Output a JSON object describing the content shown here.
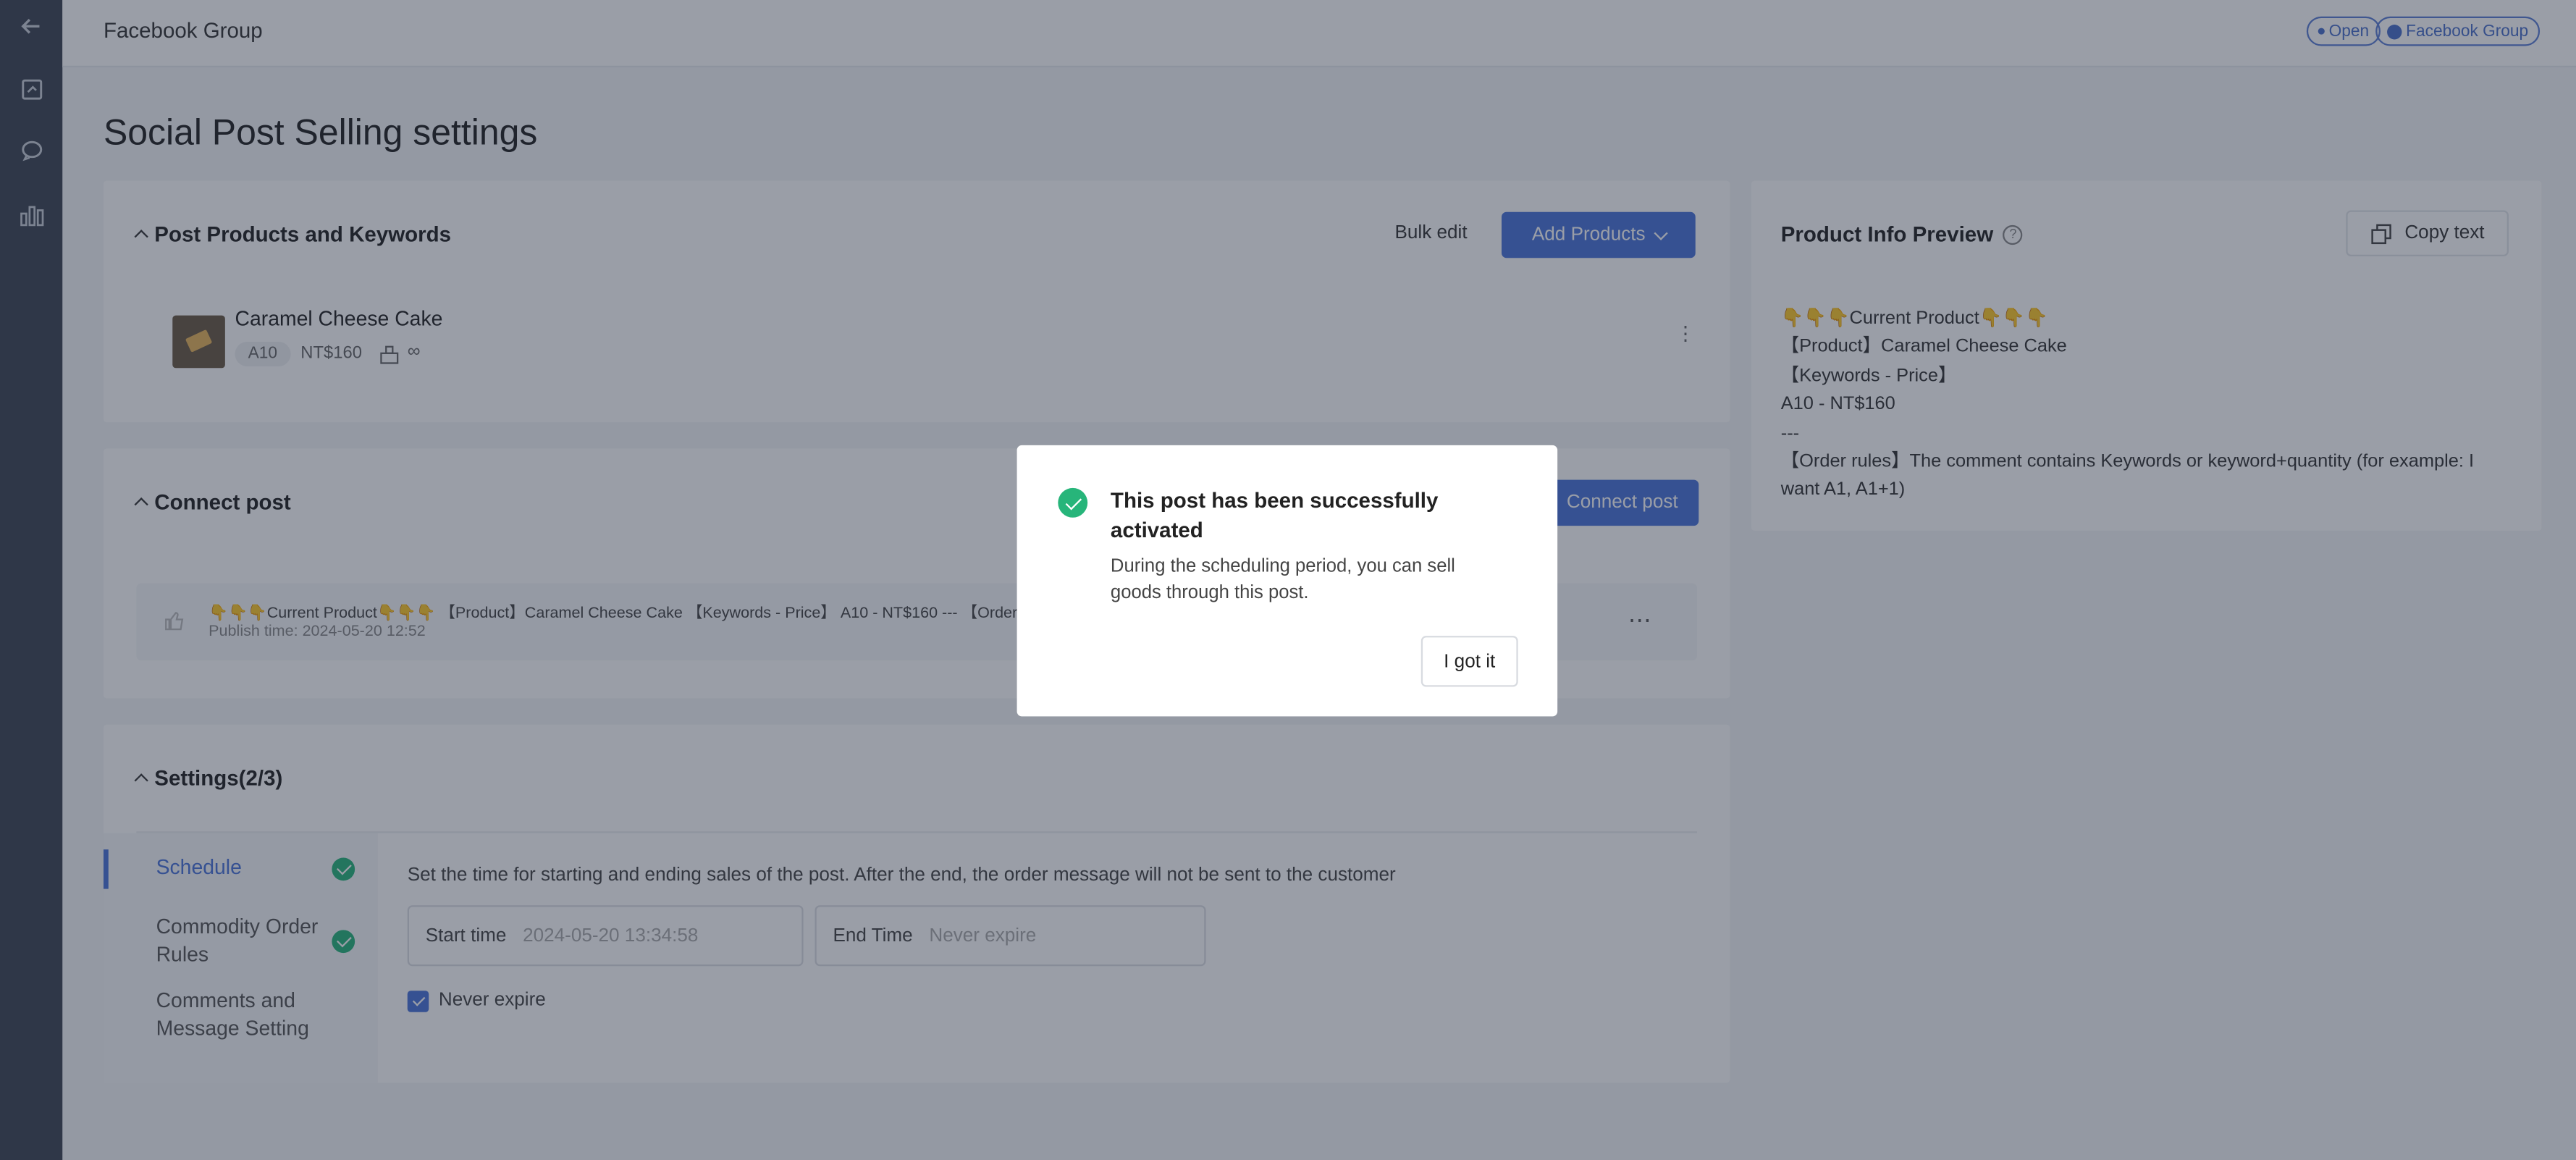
{
  "topbar": {
    "title": "Facebook Group",
    "status_pill": "Open",
    "group_pill": "Facebook Group"
  },
  "page": {
    "title": "Social Post Selling settings"
  },
  "products_card": {
    "title": "Post Products and Keywords",
    "bulk_edit_label": "Bulk edit",
    "add_products_label": "Add Products",
    "product": {
      "name": "Caramel Cheese Cake",
      "keyword": "A10",
      "price": "NT$160",
      "stock": "∞"
    }
  },
  "connect_card": {
    "title": "Connect post",
    "connect_button": "Connect post",
    "post_text": "👇👇👇Current Product👇👇👇 【Product】Caramel Cheese Cake 【Keywords - Price】 A10 - NT$160 --- 【Order rules】The comment contains Keywords or keyword+quantity (for exampl...",
    "publish_time": "Publish time: 2024-05-20 12:52"
  },
  "settings_card": {
    "title": "Settings(2/3)",
    "tabs": [
      {
        "label": "Schedule",
        "done": true
      },
      {
        "label": "Commodity Order Rules",
        "done": true
      },
      {
        "label": "Comments and Message Setting",
        "done": false
      }
    ],
    "description": "Set the time for starting and ending sales of the post. After the end, the order message will not be sent to the customer",
    "start_label": "Start time",
    "start_value": "2024-05-20 13:34:58",
    "end_label": "End Time",
    "end_placeholder": "Never expire",
    "never_expire_label": "Never expire",
    "never_expire_checked": true
  },
  "preview_card": {
    "title": "Product Info Preview",
    "copy_label": "Copy text",
    "lines": [
      "👇👇👇Current Product👇👇👇",
      "【Product】Caramel Cheese Cake",
      "【Keywords - Price】",
      "A10 - NT$160",
      "---",
      "【Order rules】The comment contains Keywords or keyword+quantity (for example: I want A1, A1+1)"
    ]
  },
  "modal": {
    "title": "This post has been successfully activated",
    "body": "During the scheduling period, you can sell goods through this post.",
    "button": "I got it"
  },
  "colors": {
    "accent": "#4a74d9",
    "success": "#27b57a",
    "sidebar": "#3c4453"
  }
}
